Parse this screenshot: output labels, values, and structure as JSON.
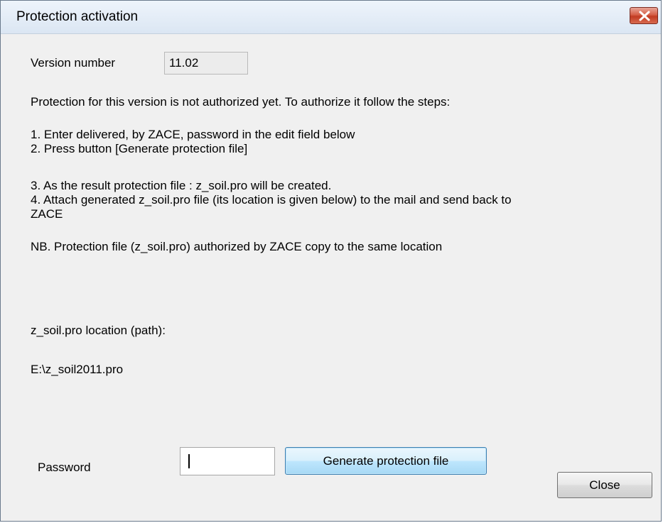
{
  "window": {
    "title": "Protection activation"
  },
  "version": {
    "label": "Version number",
    "value": "11.02"
  },
  "instructions": {
    "intro": "Protection for this version is not authorized yet. To authorize it follow the steps:",
    "step1": "1. Enter delivered, by ZACE, password in the edit field below",
    "step2": "2. Press button [Generate protection file]",
    "step3": "3. As the result protection file : z_soil.pro will be created.",
    "step4_line1": "4. Attach generated z_soil.pro file (its location is given below) to the mail and send back to",
    "step4_line2": "ZACE",
    "nb": "NB.  Protection file (z_soil.pro) authorized by ZACE copy to the same location"
  },
  "location": {
    "label": "z_soil.pro location (path):",
    "path": "E:\\z_soil2011.pro"
  },
  "password": {
    "label": "Password",
    "value": ""
  },
  "buttons": {
    "generate": "Generate protection file",
    "close": "Close"
  },
  "icons": {
    "close": "close-x-icon"
  },
  "colors": {
    "title_bar": "#dbe6f3",
    "close_button": "#c23b22",
    "dialog_bg": "#f0f0f0"
  }
}
